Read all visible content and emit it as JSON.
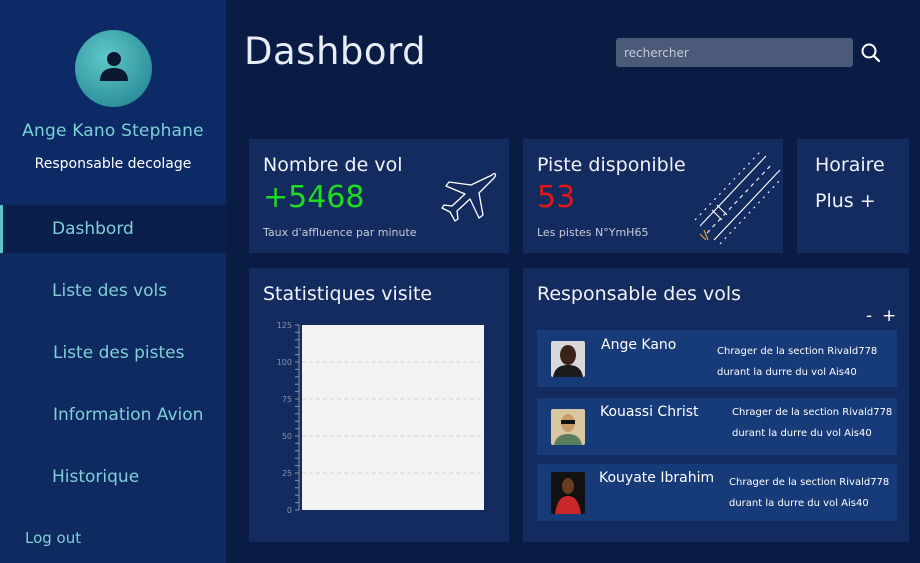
{
  "sidebar": {
    "user_name": "Ange Kano Stephane",
    "user_role": "Responsable decolage",
    "items": [
      {
        "label": "Dashbord",
        "active": true
      },
      {
        "label": "Liste des vols"
      },
      {
        "label": "Liste des pistes"
      },
      {
        "label": "Information Avion"
      },
      {
        "label": "Historique"
      }
    ],
    "logout": "Log out"
  },
  "header": {
    "title": "Dashbord",
    "search_placeholder": "rechercher",
    "search_icon": "search-icon"
  },
  "cards": {
    "vols": {
      "title": "Nombre de vol",
      "value": "+5468",
      "subtitle": "Taux d'affluence par minute",
      "icon": "airplane-icon"
    },
    "piste": {
      "title": "Piste disponible",
      "value": "53",
      "subtitle": "Les pistes N°YmH65",
      "icon": "runway-icon"
    },
    "horaire": {
      "title": "Horaire",
      "more": "Plus +"
    }
  },
  "stats": {
    "title": "Statistiques visite"
  },
  "chart_data": {
    "type": "bar",
    "categories": [],
    "values": [],
    "title": "Statistiques visite",
    "xlabel": "",
    "ylabel": "",
    "ylim": [
      0,
      125
    ],
    "yticks": [
      0,
      25,
      50,
      75,
      100,
      125
    ],
    "grid": true
  },
  "responsables": {
    "title": "Responsable des vols",
    "minus": "-",
    "plus": "+",
    "rows": [
      {
        "name": "Ange Kano",
        "line1": "Chrager de la section Rivald778",
        "line2": "durant la durre du vol Ais40"
      },
      {
        "name": "Kouassi Christ",
        "line1": "Chrager de la section Rivald778",
        "line2": "durant la durre du vol Ais40"
      },
      {
        "name": "Kouyate Ibrahim",
        "line1": "Chrager de la section Rivald778",
        "line2": "durant la durre du vol Ais40"
      }
    ]
  },
  "colors": {
    "background": "#0a1c44",
    "card": "#132b5e",
    "accent_teal": "#80cfd6",
    "value_green": "#1fdc1f",
    "value_red": "#e01717"
  }
}
